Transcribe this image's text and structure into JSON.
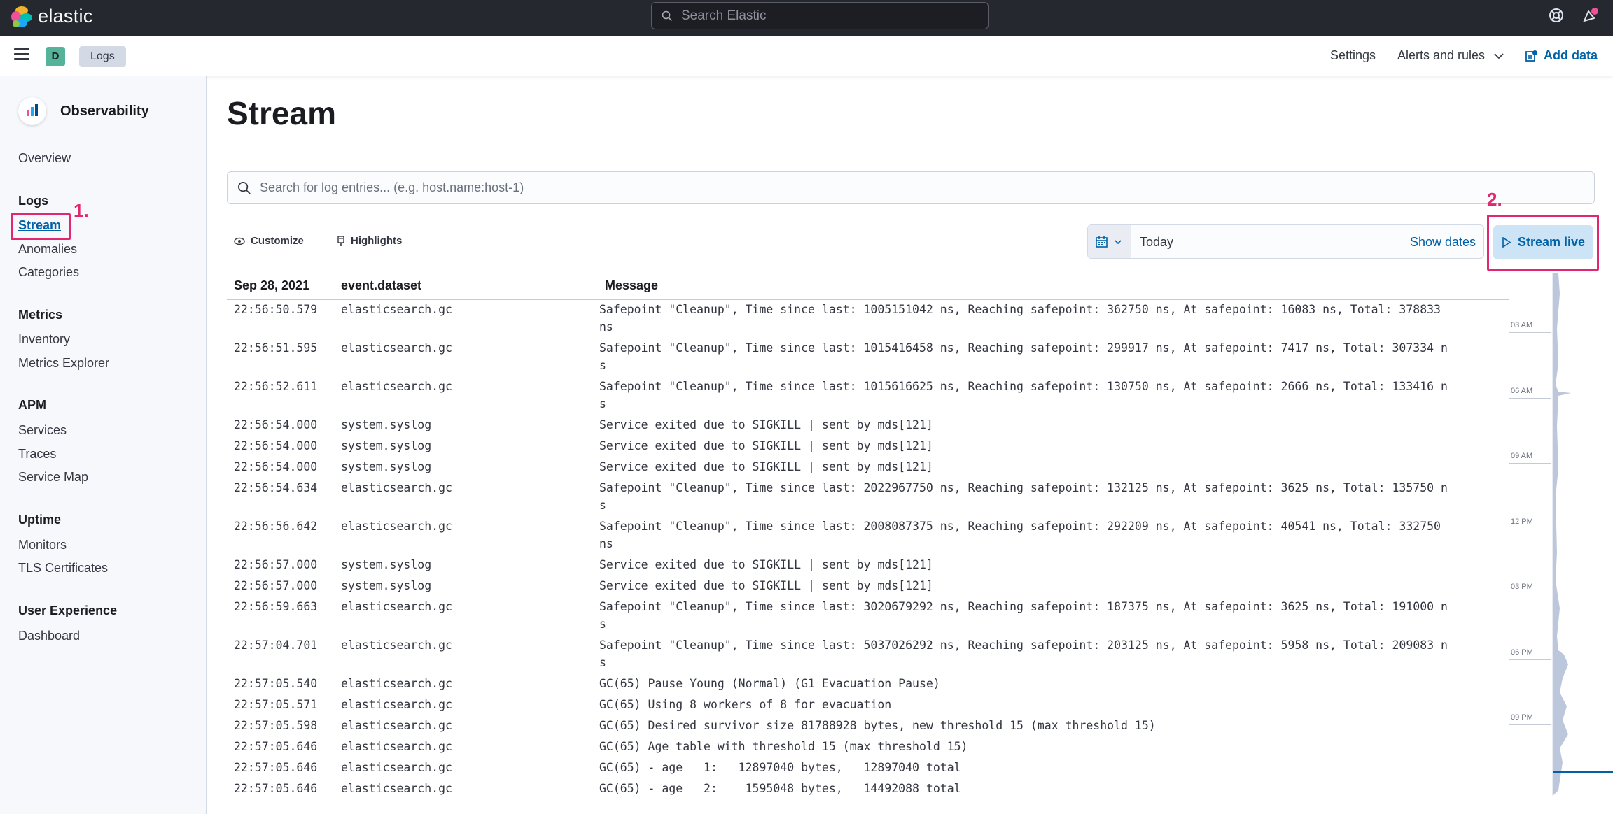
{
  "header": {
    "brand": "elastic",
    "search_placeholder": "Search Elastic"
  },
  "subbar": {
    "space_initial": "D",
    "breadcrumb": "Logs",
    "settings": "Settings",
    "alerts": "Alerts and rules",
    "add_data": "Add data"
  },
  "sidebar": {
    "title": "Observability",
    "overview": "Overview",
    "sections": {
      "logs": "Logs",
      "metrics": "Metrics",
      "apm": "APM",
      "uptime": "Uptime",
      "ux": "User Experience"
    },
    "items": {
      "stream": "Stream",
      "anomalies": "Anomalies",
      "categories": "Categories",
      "inventory": "Inventory",
      "metrics_explorer": "Metrics Explorer",
      "services": "Services",
      "traces": "Traces",
      "service_map": "Service Map",
      "monitors": "Monitors",
      "tls": "TLS Certificates",
      "dashboard": "Dashboard"
    }
  },
  "annotations": {
    "one": "1.",
    "two": "2."
  },
  "main": {
    "title": "Stream",
    "search_placeholder": "Search for log entries... (e.g. host.name:host-1)",
    "customize": "Customize",
    "highlights": "Highlights",
    "date_value": "Today",
    "show_dates": "Show dates",
    "stream_live": "Stream live"
  },
  "table": {
    "headers": {
      "date": "Sep 28, 2021",
      "dataset": "event.dataset",
      "message": "Message"
    },
    "rows": [
      {
        "time": "22:56:50.579",
        "dataset": "elasticsearch.gc",
        "message": "Safepoint \"Cleanup\", Time since last: 1005151042 ns, Reaching safepoint: 362750 ns, At safepoint: 16083 ns, Total: 378833 ns"
      },
      {
        "time": "22:56:51.595",
        "dataset": "elasticsearch.gc",
        "message": "Safepoint \"Cleanup\", Time since last: 1015416458 ns, Reaching safepoint: 299917 ns, At safepoint: 7417 ns, Total: 307334 ns"
      },
      {
        "time": "22:56:52.611",
        "dataset": "elasticsearch.gc",
        "message": "Safepoint \"Cleanup\", Time since last: 1015616625 ns, Reaching safepoint: 130750 ns, At safepoint: 2666 ns, Total: 133416 ns"
      },
      {
        "time": "22:56:54.000",
        "dataset": "system.syslog",
        "message": "Service exited due to SIGKILL | sent by mds[121]"
      },
      {
        "time": "22:56:54.000",
        "dataset": "system.syslog",
        "message": "Service exited due to SIGKILL | sent by mds[121]"
      },
      {
        "time": "22:56:54.000",
        "dataset": "system.syslog",
        "message": "Service exited due to SIGKILL | sent by mds[121]"
      },
      {
        "time": "22:56:54.634",
        "dataset": "elasticsearch.gc",
        "message": "Safepoint \"Cleanup\", Time since last: 2022967750 ns, Reaching safepoint: 132125 ns, At safepoint: 3625 ns, Total: 135750 ns"
      },
      {
        "time": "22:56:56.642",
        "dataset": "elasticsearch.gc",
        "message": "Safepoint \"Cleanup\", Time since last: 2008087375 ns, Reaching safepoint: 292209 ns, At safepoint: 40541 ns, Total: 332750 ns"
      },
      {
        "time": "22:56:57.000",
        "dataset": "system.syslog",
        "message": "Service exited due to SIGKILL | sent by mds[121]"
      },
      {
        "time": "22:56:57.000",
        "dataset": "system.syslog",
        "message": "Service exited due to SIGKILL | sent by mds[121]"
      },
      {
        "time": "22:56:59.663",
        "dataset": "elasticsearch.gc",
        "message": "Safepoint \"Cleanup\", Time since last: 3020679292 ns, Reaching safepoint: 187375 ns, At safepoint: 3625 ns, Total: 191000 ns"
      },
      {
        "time": "22:57:04.701",
        "dataset": "elasticsearch.gc",
        "message": "Safepoint \"Cleanup\", Time since last: 5037026292 ns, Reaching safepoint: 203125 ns, At safepoint: 5958 ns, Total: 209083 ns"
      },
      {
        "time": "22:57:05.540",
        "dataset": "elasticsearch.gc",
        "message": "GC(65) Pause Young (Normal) (G1 Evacuation Pause)"
      },
      {
        "time": "22:57:05.571",
        "dataset": "elasticsearch.gc",
        "message": "GC(65) Using 8 workers of 8 for evacuation"
      },
      {
        "time": "22:57:05.598",
        "dataset": "elasticsearch.gc",
        "message": "GC(65) Desired survivor size 81788928 bytes, new threshold 15 (max threshold 15)"
      },
      {
        "time": "22:57:05.646",
        "dataset": "elasticsearch.gc",
        "message": "GC(65) Age table with threshold 15 (max threshold 15)"
      },
      {
        "time": "22:57:05.646",
        "dataset": "elasticsearch.gc",
        "message": "GC(65) - age   1:   12897040 bytes,   12897040 total"
      },
      {
        "time": "22:57:05.646",
        "dataset": "elasticsearch.gc",
        "message": "GC(65) - age   2:    1595048 bytes,   14492088 total"
      }
    ]
  },
  "minimap": {
    "labels": [
      "03 AM",
      "06 AM",
      "09 AM",
      "12 PM",
      "03 PM",
      "06 PM",
      "09 PM"
    ]
  },
  "colors": {
    "accent": "#0061a6",
    "annotation": "#e0276f",
    "header_bg": "#25282f"
  }
}
